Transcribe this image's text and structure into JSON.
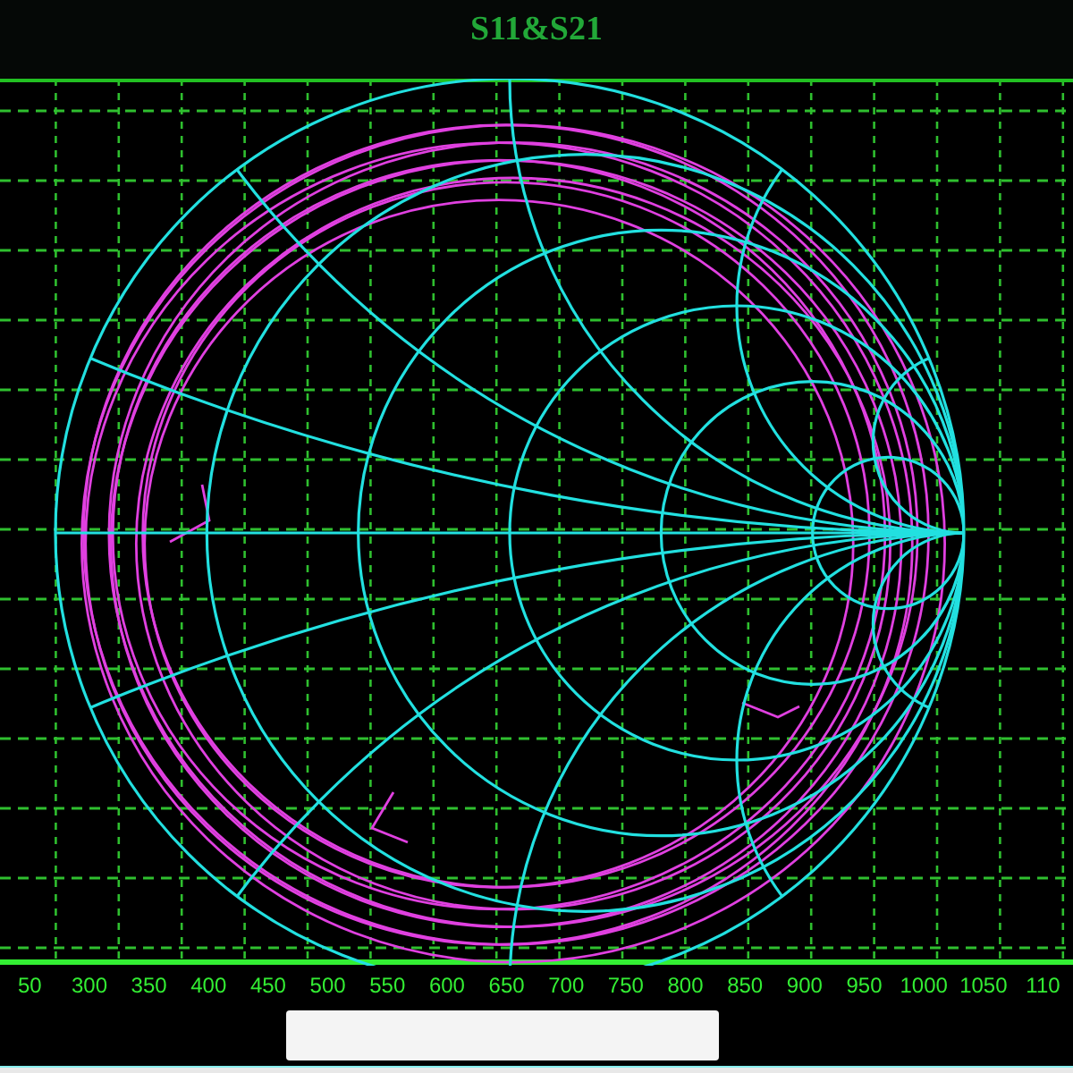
{
  "title": "S11&S21",
  "x_axis": {
    "labels": [
      "50",
      "300",
      "350",
      "400",
      "450",
      "500",
      "550",
      "600",
      "650",
      "700",
      "750",
      "800",
      "850",
      "900",
      "950",
      "1000",
      "1050",
      "110"
    ]
  }
}
